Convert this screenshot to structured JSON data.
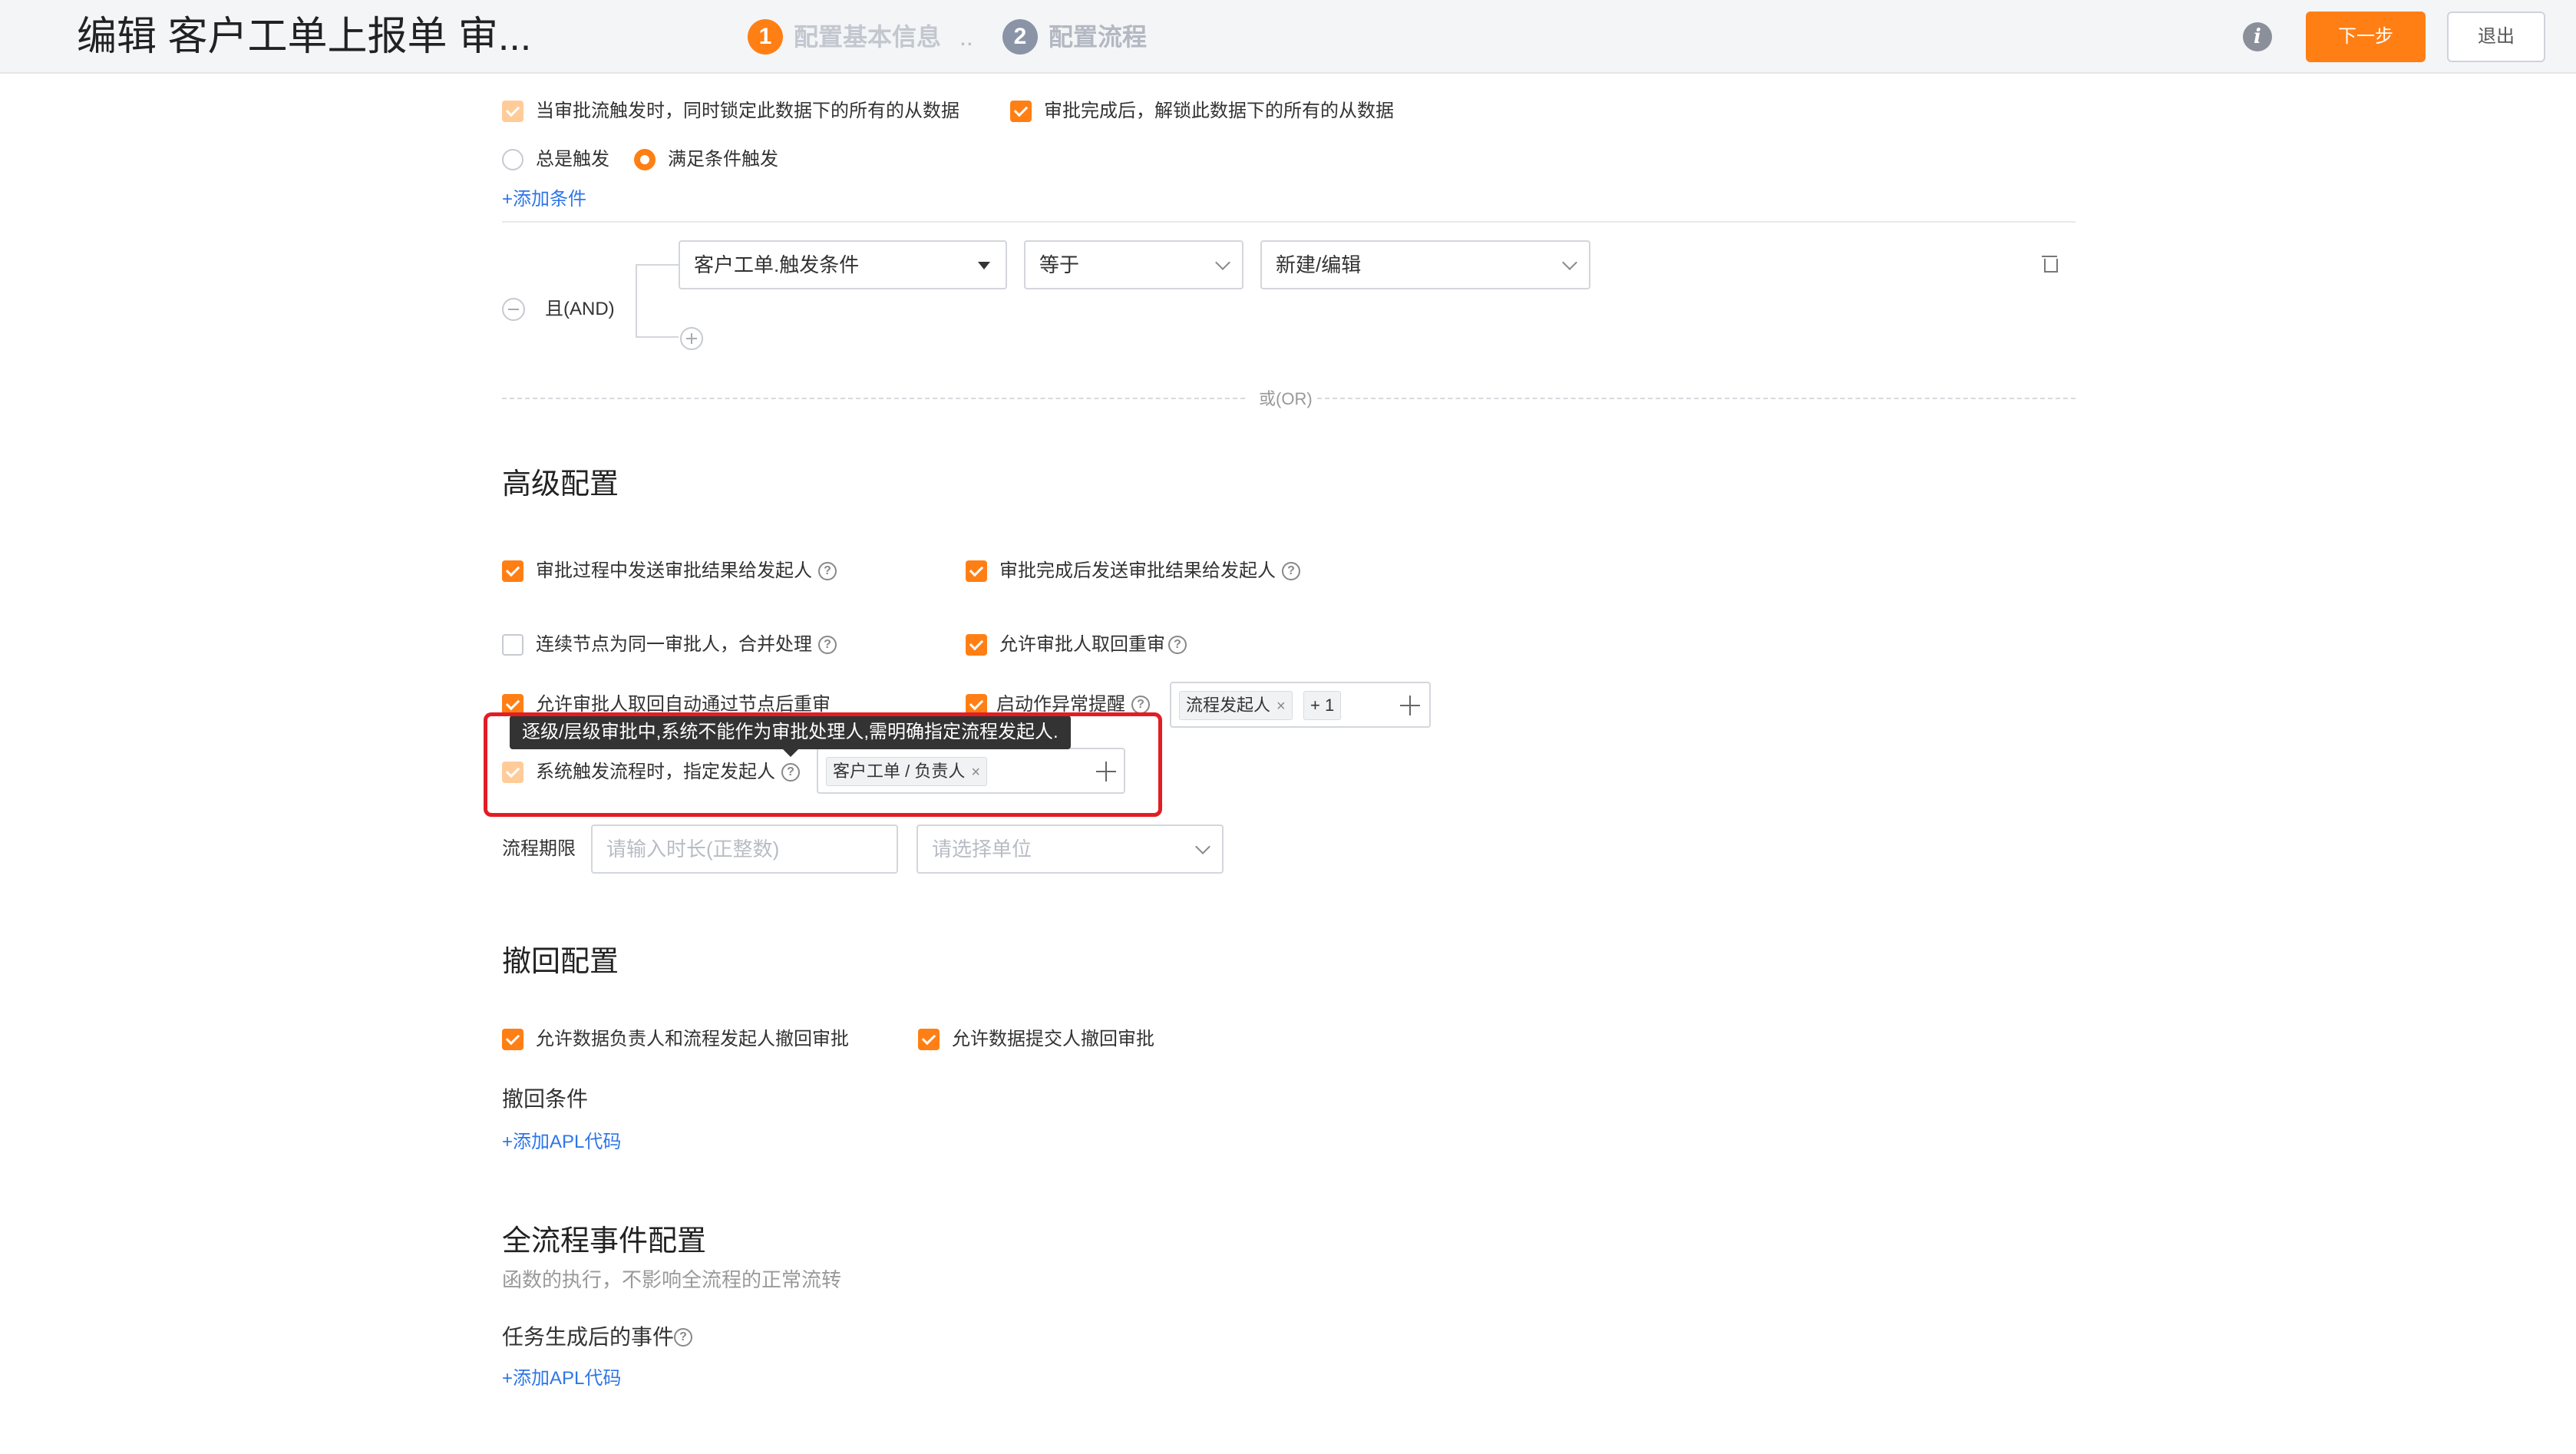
{
  "header": {
    "title": "编辑 客户工单上报单 审...",
    "steps": [
      {
        "num": "1",
        "label": "配置基本信息",
        "color": "#ff7f15"
      },
      {
        "num": "2",
        "label": "配置流程",
        "color": "#8b93a6"
      }
    ],
    "step_separator": "..",
    "info_icon": "i",
    "next_label": "下一步",
    "exit_label": "退出"
  },
  "trigger": {
    "lock_label": "当审批流触发时，同时锁定此数据下的所有的从数据",
    "unlock_label": "审批完成后，解锁此数据下的所有的从数据",
    "always_label": "总是触发",
    "condition_label": "满足条件触发",
    "add_condition": "+添加条件",
    "and_label": "且(AND)",
    "field_value": "客户工单.触发条件",
    "operator_value": "等于",
    "value_value": "新建/编辑",
    "or_label": "或(OR)"
  },
  "advanced": {
    "title": "高级配置",
    "send_during": "审批过程中发送审批结果给发起人",
    "send_after": "审批完成后发送审批结果给发起人",
    "merge_nodes": "连续节点为同一审批人，合并处理",
    "allow_retrieve": "允许审批人取回重审",
    "auto_pass": "允许审批人取回自动通过节点后重审",
    "exception_remind": "启动作异常提醒",
    "remind_tag": "流程发起人",
    "remind_more": "+ 1",
    "tooltip": "逐级/层级审批中,系统不能作为审批处理人,需明确指定流程发起人.",
    "system_trigger": "系统触发流程时，指定发起人",
    "initiator_tag": "客户工单 / 负责人",
    "period_label": "流程期限",
    "period_placeholder": "请输入时长(正整数)",
    "unit_placeholder": "请选择单位",
    "help": "?"
  },
  "withdraw": {
    "title": "撤回配置",
    "owner_label": "允许数据负责人和流程发起人撤回审批",
    "submitter_label": "允许数据提交人撤回审批",
    "condition_title": "撤回条件",
    "add_apl": "+添加APL代码"
  },
  "events": {
    "title": "全流程事件配置",
    "subtitle": "函数的执行，不影响全流程的正常流转",
    "task_event": "任务生成后的事件",
    "add_apl": "+添加APL代码"
  },
  "tag_close": "×"
}
